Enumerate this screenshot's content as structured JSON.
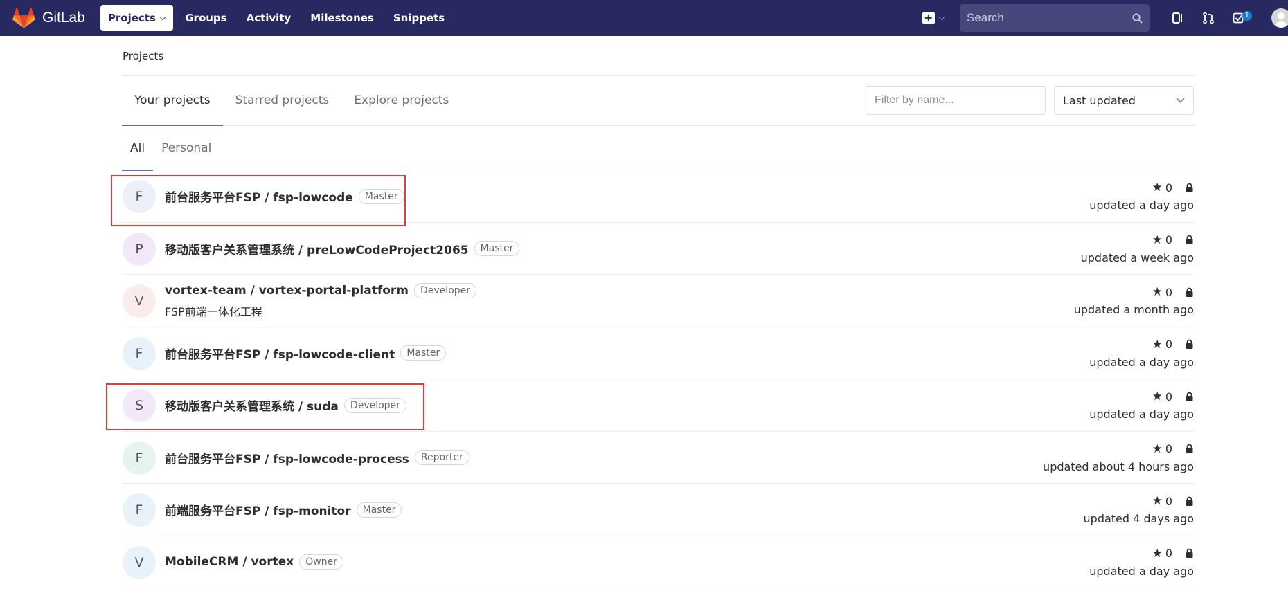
{
  "navbar": {
    "brand": "GitLab",
    "links": [
      {
        "label": "Projects",
        "active": true
      },
      {
        "label": "Groups"
      },
      {
        "label": "Activity"
      },
      {
        "label": "Milestones"
      },
      {
        "label": "Snippets"
      }
    ],
    "search_placeholder": "Search",
    "todos_count": "1"
  },
  "breadcrumb": "Projects",
  "tabs": [
    "Your projects",
    "Starred projects",
    "Explore projects"
  ],
  "filter_placeholder": "Filter by name...",
  "sort_label": "Last updated",
  "subtabs": [
    "All",
    "Personal"
  ],
  "projects": [
    {
      "initial": "F",
      "name": "前台服务平台FSP / fsp-lowcode",
      "role": "Master",
      "desc": "",
      "stars": "0",
      "updated": "updated a day ago",
      "avatar_color": "#eef0f9"
    },
    {
      "initial": "P",
      "name": "移动版客户关系管理系统 / preLowCodeProject2065",
      "role": "Master",
      "desc": "",
      "stars": "0",
      "updated": "updated a week ago",
      "avatar_color": "#f3e8f7"
    },
    {
      "initial": "V",
      "name": "vortex-team / vortex-portal-platform",
      "role": "Developer",
      "desc": "FSP前端一体化工程",
      "stars": "0",
      "updated": "updated a month ago",
      "avatar_color": "#fbecec"
    },
    {
      "initial": "F",
      "name": "前台服务平台FSP / fsp-lowcode-client",
      "role": "Master",
      "desc": "",
      "stars": "0",
      "updated": "updated a day ago",
      "avatar_color": "#e8f2fb"
    },
    {
      "initial": "S",
      "name": "移动版客户关系管理系统 / suda",
      "role": "Developer",
      "desc": "",
      "stars": "0",
      "updated": "updated a day ago",
      "avatar_color": "#f3e8f7"
    },
    {
      "initial": "F",
      "name": "前台服务平台FSP / fsp-lowcode-process",
      "role": "Reporter",
      "desc": "",
      "stars": "0",
      "updated": "updated about 4 hours ago",
      "avatar_color": "#e6f4f1"
    },
    {
      "initial": "F",
      "name": "前端服务平台FSP / fsp-monitor",
      "role": "Master",
      "desc": "",
      "stars": "0",
      "updated": "updated 4 days ago",
      "avatar_color": "#e8f2fb"
    },
    {
      "initial": "V",
      "name": "MobileCRM / vortex",
      "role": "Owner",
      "desc": "",
      "stars": "0",
      "updated": "updated a day ago",
      "avatar_color": "#e8f2fb"
    }
  ],
  "colors": {
    "navbar": "#292961",
    "accent": "#6666c4",
    "highlight": "#e53935"
  }
}
